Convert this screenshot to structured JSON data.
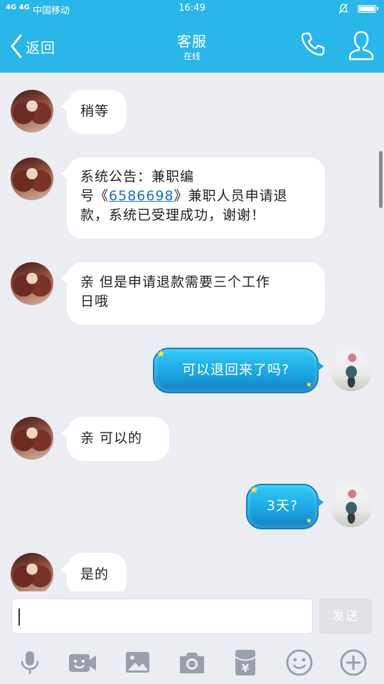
{
  "status": {
    "network": "4G 4G",
    "carrier": "中国移动",
    "time": "16:49"
  },
  "header": {
    "back_label": "返回",
    "title": "客服",
    "subtitle": "在线"
  },
  "messages": [
    {
      "side": "left",
      "text": "稍等"
    },
    {
      "side": "left",
      "text_a": "系统公告：兼职编",
      "text_b": "号《",
      "link": "6586698",
      "text_c": "》兼职人员申请退",
      "text_d": "款，系统已受理成功，谢谢！"
    },
    {
      "side": "left",
      "text_a": "亲  但是申请退款需要三个工作",
      "text_b": "日哦"
    },
    {
      "side": "right",
      "text": "可以退回来了吗?"
    },
    {
      "side": "left",
      "text": "亲  可以的"
    },
    {
      "side": "right",
      "text": "3天?"
    },
    {
      "side": "left",
      "text": "是的"
    }
  ],
  "input": {
    "value": "",
    "send_label": "发送"
  },
  "toolbar": {
    "icons": [
      "microphone-icon",
      "video-call-icon",
      "image-icon",
      "camera-icon",
      "red-packet-icon",
      "emoji-icon",
      "plus-icon"
    ]
  },
  "colors": {
    "accent": "#29b6e8",
    "background": "#ebedf2",
    "bubble_left": "#ffffff",
    "bubble_right": "#1aa3e0",
    "link": "#1a6fd0",
    "icon_gray": "#9aa0ab"
  }
}
